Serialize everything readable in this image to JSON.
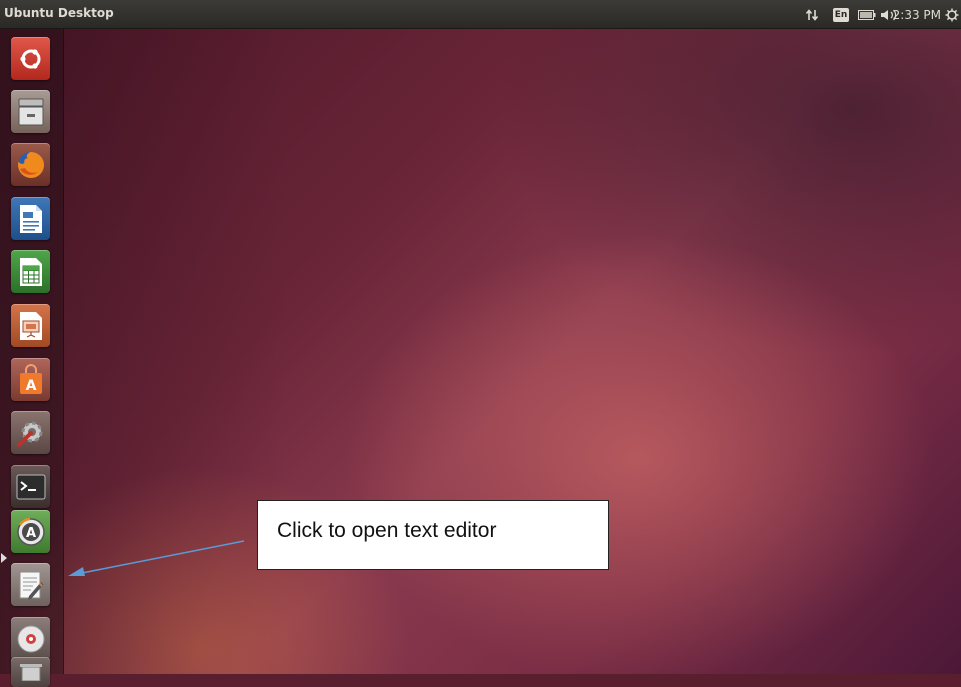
{
  "topbar": {
    "title": "Ubuntu Desktop",
    "keyboard": "En",
    "time": "2:33 PM"
  },
  "launcher": {
    "items": [
      {
        "name": "Dash home",
        "icon": "ubuntu-logo-icon"
      },
      {
        "name": "Files",
        "icon": "file-cabinet-icon"
      },
      {
        "name": "Firefox Web Browser",
        "icon": "firefox-icon"
      },
      {
        "name": "LibreOffice Writer",
        "icon": "writer-document-icon"
      },
      {
        "name": "LibreOffice Calc",
        "icon": "calc-spreadsheet-icon"
      },
      {
        "name": "LibreOffice Impress",
        "icon": "impress-presentation-icon"
      },
      {
        "name": "Ubuntu Software Center",
        "icon": "software-center-bag-icon"
      },
      {
        "name": "System Settings",
        "icon": "settings-wrench-gear-icon"
      },
      {
        "name": "Terminal",
        "icon": "terminal-icon"
      },
      {
        "name": "Software Updater",
        "icon": "software-updater-icon"
      },
      {
        "name": "Text Editor",
        "icon": "text-editor-icon"
      },
      {
        "name": "Optical Drive",
        "icon": "disc-icon"
      },
      {
        "name": "Trash",
        "icon": "trash-icon"
      }
    ]
  },
  "annotation": {
    "text": "Click to open text editor",
    "arrow_color": "#5b9bd5"
  },
  "colors": {
    "topbar": "#2b2925",
    "desktop": "#6a2538",
    "accent": "#e95420"
  }
}
